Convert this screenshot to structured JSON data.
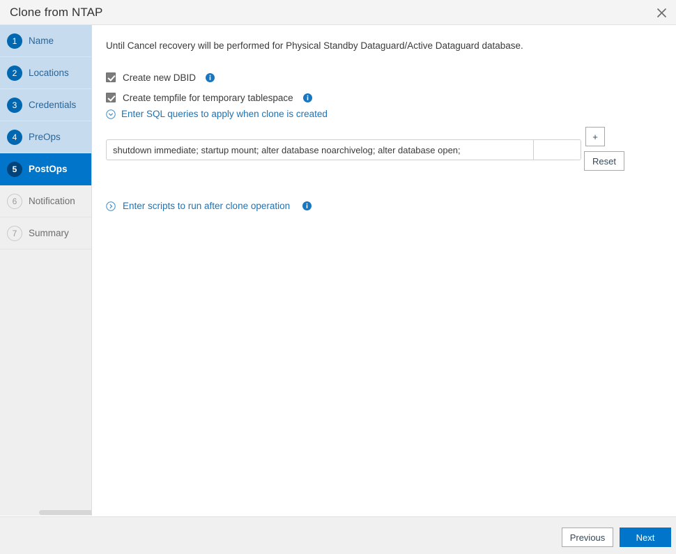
{
  "dialog": {
    "title": "Clone from NTAP",
    "close_icon": "close-icon"
  },
  "sidebar": {
    "steps": [
      {
        "num": "1",
        "label": "Name",
        "state": "done"
      },
      {
        "num": "2",
        "label": "Locations",
        "state": "done"
      },
      {
        "num": "3",
        "label": "Credentials",
        "state": "done"
      },
      {
        "num": "4",
        "label": "PreOps",
        "state": "done"
      },
      {
        "num": "5",
        "label": "PostOps",
        "state": "active"
      },
      {
        "num": "6",
        "label": "Notification",
        "state": "pending"
      },
      {
        "num": "7",
        "label": "Summary",
        "state": "pending"
      }
    ]
  },
  "main": {
    "intro_text": "Until Cancel recovery will be performed for Physical Standby Dataguard/Active Dataguard database.",
    "checkboxes": [
      {
        "label": "Create new DBID",
        "checked": true,
        "info_icon": "info-icon"
      },
      {
        "label": "Create tempfile for temporary tablespace",
        "checked": true,
        "info_icon": "info-icon"
      }
    ],
    "sql_section": {
      "toggle_label": "Enter SQL queries to apply when clone is created",
      "toggle_icon": "chevron-down-circle-icon",
      "expanded": true,
      "query_value": "shutdown immediate; startup mount; alter database noarchivelog; alter database open;",
      "query_placeholder": "",
      "add_button_label": "+",
      "reset_button_label": "Reset"
    },
    "scripts_section": {
      "toggle_label": "Enter scripts to run after clone operation",
      "toggle_icon": "chevron-right-circle-icon",
      "expanded": false,
      "info_icon": "info-icon"
    }
  },
  "footer": {
    "previous_label": "Previous",
    "next_label": "Next"
  },
  "colors": {
    "accent": "#0075c9",
    "step_done_bg": "#c6dcee",
    "step_active_bg": "#0075c9",
    "link": "#1a74b8"
  }
}
